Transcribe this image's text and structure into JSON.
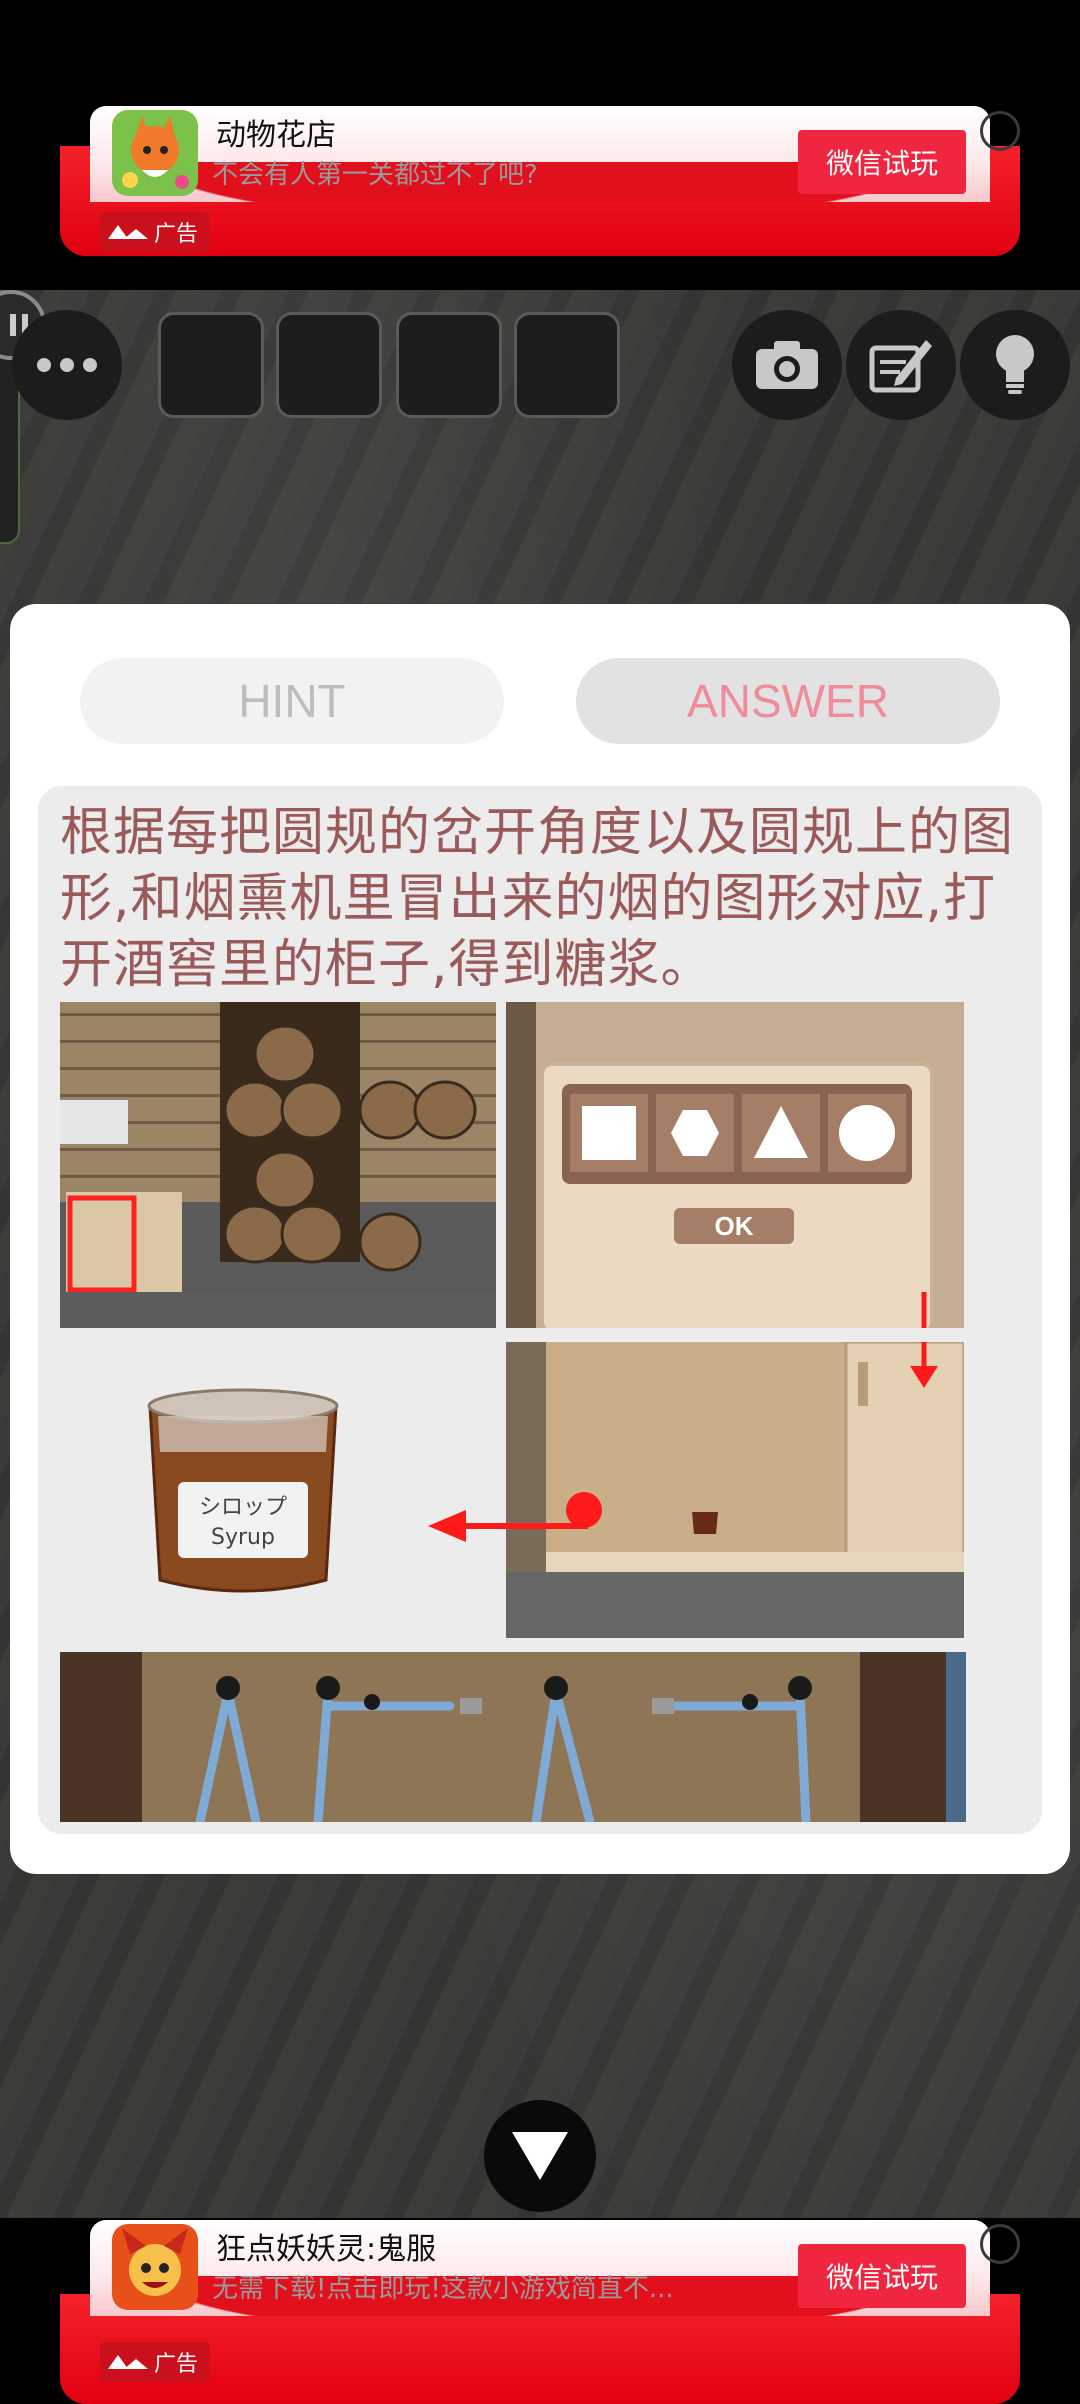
{
  "ads": {
    "top": {
      "title": "动物花店",
      "subtitle": "不会有人第一关都过不了吧?",
      "button": "微信试玩",
      "label": "广告"
    },
    "bottom": {
      "title": "狂点妖妖灵:鬼服",
      "subtitle": "无需下载!点击即玩!这款小游戏简直不...",
      "button": "微信试玩",
      "label": "广告"
    }
  },
  "toolbar": {
    "menu_icon": "more-dots-icon",
    "camera_icon": "camera-icon",
    "memo_icon": "memo-pencil-icon",
    "hint_icon": "lightbulb-icon",
    "inventory_slots": 4
  },
  "dialog": {
    "tabs": {
      "hint": "HINT",
      "answer": "ANSWER"
    },
    "active_tab": "answer",
    "answer_text": "根据每把圆规的岔开角度以及圆规上的图形,和烟熏机里冒出来的烟的图形对应,打开酒窖里的柜子,得到糖浆。",
    "puzzle": {
      "ok_label": "OK",
      "shapes": [
        "square",
        "hexagon",
        "triangle",
        "circle"
      ]
    },
    "syrup_label_jp": "シロップ",
    "syrup_label_en": "Syrup"
  },
  "close_button_icon": "down-triangle-icon",
  "colors": {
    "accent_red": "#e10012",
    "answer_text": "#9b5a5a",
    "answer_tab": "#f08c9a"
  }
}
